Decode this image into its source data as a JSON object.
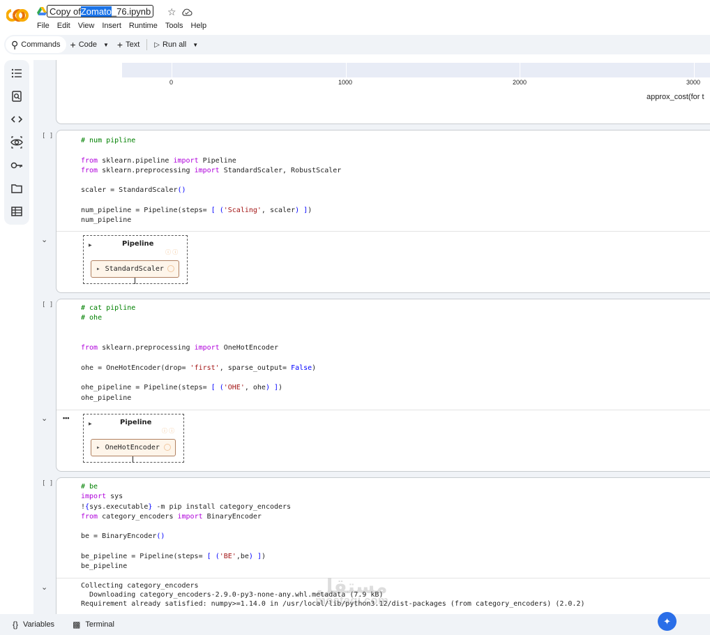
{
  "header": {
    "title_prefix": "Copy of ",
    "title_selected": "Zomato",
    "title_suffix": "_76.ipynb",
    "menu": [
      "File",
      "Edit",
      "View",
      "Insert",
      "Runtime",
      "Tools",
      "Help"
    ]
  },
  "toolbar": {
    "commands": "Commands",
    "code": "Code",
    "text": "Text",
    "run_all": "Run all"
  },
  "sidebar": {
    "icons": [
      "table-of-contents-icon",
      "find-icon",
      "code-snippets-icon",
      "variables-inspector-icon",
      "secrets-key-icon",
      "files-folder-icon",
      "data-table-icon"
    ]
  },
  "chart_data": {
    "type": "bar",
    "x_ticks": [
      "0",
      "1000",
      "2000",
      "3000"
    ],
    "xlabel": "approx_cost(for t"
  },
  "cells": [
    {
      "bracket": "[ ]",
      "code": [
        "# num pipline",
        "",
        "from sklearn.pipeline import Pipeline",
        "from sklearn.preprocessing import StandardScaler, RobustScaler",
        "",
        "scaler = StandardScaler()",
        "",
        "num_pipeline = Pipeline(steps= [ ('Scaling', scaler) ])",
        "num_pipeline"
      ],
      "output": {
        "pipeline_title": "Pipeline",
        "step": "StandardScaler"
      }
    },
    {
      "bracket": "[ ]",
      "code": [
        "# cat pipline",
        "# ohe",
        "",
        "",
        "from sklearn.preprocessing import OneHotEncoder",
        "",
        "ohe = OneHotEncoder(drop= 'first', sparse_output= False)",
        "",
        "ohe_pipeline = Pipeline(steps= [ ('OHE', ohe) ])",
        "ohe_pipeline"
      ],
      "output": {
        "pipeline_title": "Pipeline",
        "step": "OneHotEncoder",
        "more": "•••"
      }
    },
    {
      "bracket": "[ ]",
      "code": [
        "# be",
        "import sys",
        "!{sys.executable} -m pip install category_encoders",
        "from category_encoders import BinaryEncoder",
        "",
        "be = BinaryEncoder()",
        "",
        "be_pipeline = Pipeline(steps= [ ('BE',be) ])",
        "be_pipeline"
      ],
      "output_lines": [
        "Collecting category_encoders",
        "  Downloading category_encoders-2.9.0-py3-none-any.whl.metadata (7.9 kB)",
        "Requirement already satisfied: numpy>=1.14.0 in /usr/local/lib/python3.12/dist-packages (from category_encoders) (2.0.2)"
      ]
    }
  ],
  "bottombar": {
    "variables": "Variables",
    "terminal": "Terminal"
  },
  "watermark": {
    "arabic": "مستقل",
    "latin": "mostaqi.com"
  }
}
